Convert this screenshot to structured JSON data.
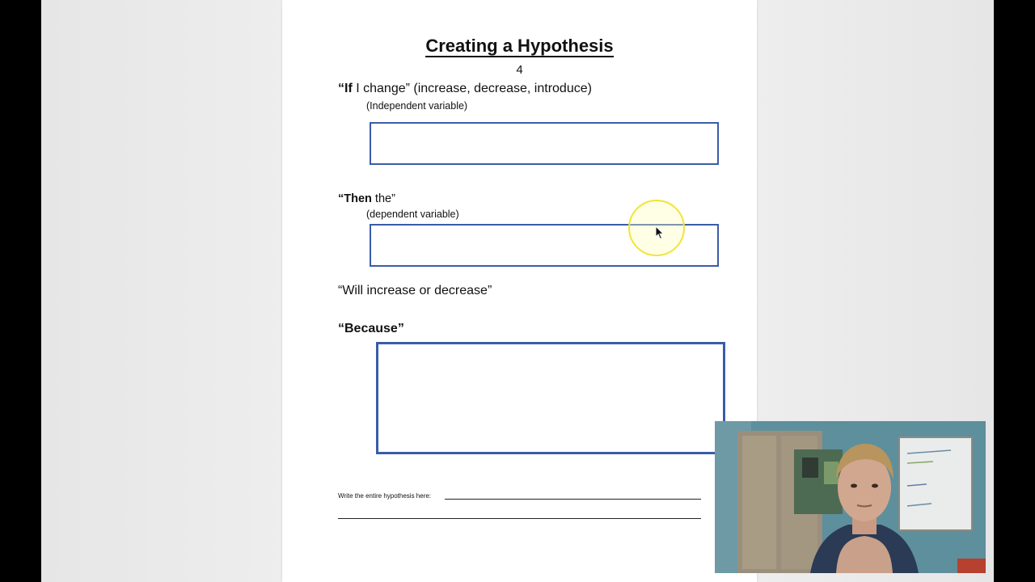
{
  "document": {
    "title": "Creating a Hypothesis",
    "page_number": "4",
    "if_bold": "“If",
    "if_rest": " I change” (increase, decrease, introduce)",
    "independent_hint": "(Independent variable)",
    "then_bold": "“Then",
    "then_rest": " the”",
    "dependent_hint": "(dependent variable)",
    "will_line": "“Will increase or decrease”",
    "because": "“Because”",
    "write_label": "Write the entire hypothesis here:"
  },
  "colors": {
    "box_border": "#3a5ca8",
    "cursor_ring": "#f1e43a",
    "page": "#ffffff",
    "background": "#efefef"
  },
  "icons": {
    "pointer": "arrow-cursor-icon",
    "highlight": "cursor-highlight-ring"
  },
  "webcam": {
    "description_visible": false
  }
}
